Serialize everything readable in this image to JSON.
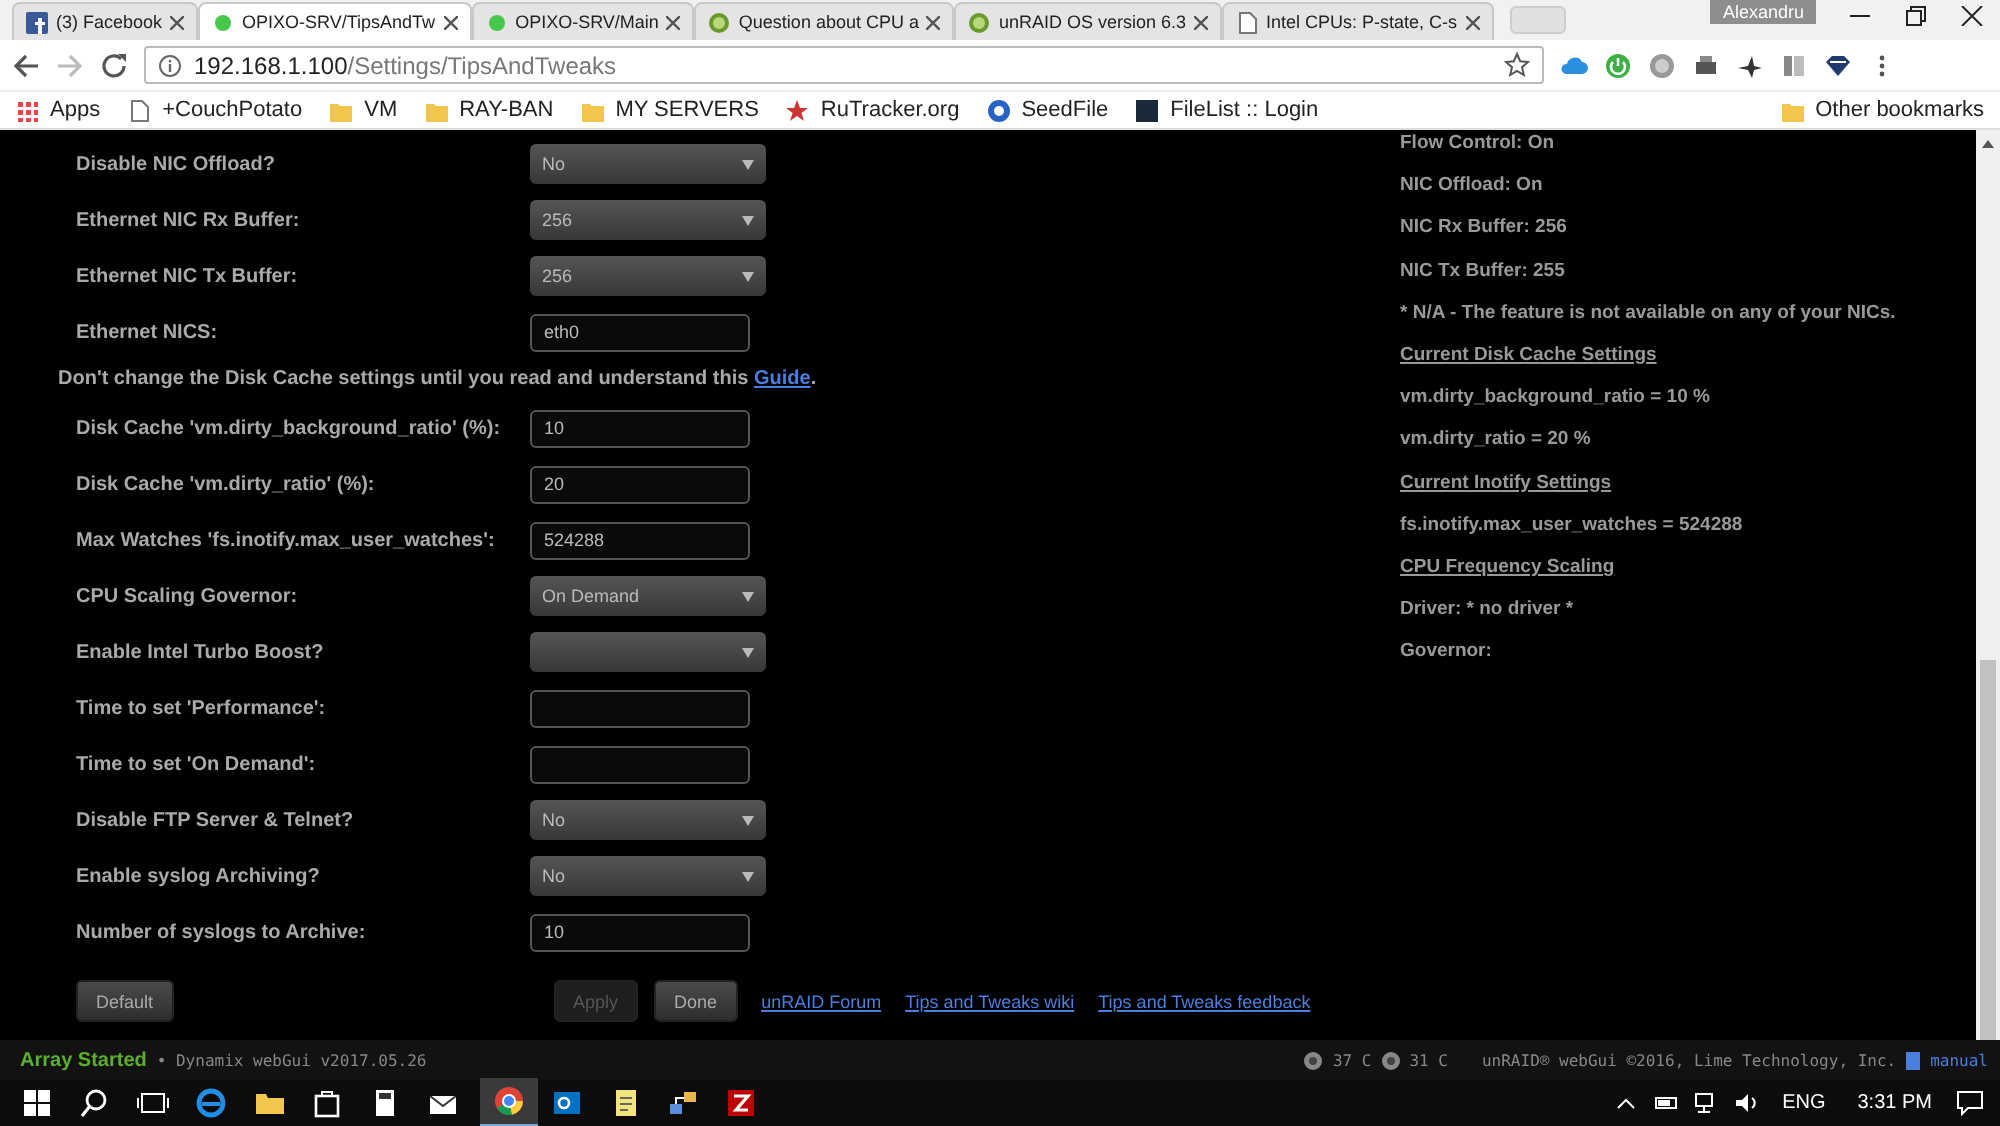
{
  "window": {
    "user": "Alexandru"
  },
  "tabs": [
    {
      "title": "(3) Facebook",
      "selected": false
    },
    {
      "title": "OPIXO-SRV/TipsAndTw",
      "selected": true
    },
    {
      "title": "OPIXO-SRV/Main",
      "selected": false
    },
    {
      "title": "Question about CPU a",
      "selected": false
    },
    {
      "title": "unRAID OS version 6.3",
      "selected": false
    },
    {
      "title": "Intel CPUs: P-state, C-s",
      "selected": false
    }
  ],
  "address": {
    "host": "192.168.1.100",
    "path": "/Settings/TipsAndTweaks"
  },
  "bookmarks": [
    "Apps",
    "+CouchPotato",
    "VM",
    "RAY-BAN",
    "MY SERVERS",
    "RuTracker.org",
    "SeedFile",
    "FileList :: Login"
  ],
  "other_bookmarks": "Other bookmarks",
  "settings": [
    {
      "kind": "select",
      "label": "Disable NIC Offload?",
      "value": "No"
    },
    {
      "kind": "select",
      "label": "Ethernet NIC Rx Buffer:",
      "value": "256"
    },
    {
      "kind": "select",
      "label": "Ethernet NIC Tx Buffer:",
      "value": "256"
    },
    {
      "kind": "input",
      "label": "Ethernet NICS:",
      "value": "eth0"
    },
    {
      "kind": "note",
      "text": "Don't change the Disk Cache settings until you read and understand this",
      "link": "Guide",
      "after": "."
    },
    {
      "kind": "input",
      "label": "Disk Cache 'vm.dirty_background_ratio' (%):",
      "value": "10"
    },
    {
      "kind": "input",
      "label": "Disk Cache 'vm.dirty_ratio' (%):",
      "value": "20"
    },
    {
      "kind": "input",
      "label": "Max Watches 'fs.inotify.max_user_watches':",
      "value": "524288"
    },
    {
      "kind": "select",
      "label": "CPU Scaling Governor:",
      "value": "On Demand"
    },
    {
      "kind": "select",
      "label": "Enable Intel Turbo Boost?"
    },
    {
      "kind": "input",
      "label": "Time to set 'Performance':"
    },
    {
      "kind": "input",
      "label": "Time to set 'On Demand':"
    },
    {
      "kind": "select",
      "label": "Disable FTP Server & Telnet?",
      "value": "No"
    },
    {
      "kind": "select",
      "label": "Enable syslog Archiving?",
      "value": "No"
    },
    {
      "kind": "input",
      "label": "Number of syslogs to Archive:",
      "value": "10"
    }
  ],
  "buttons": [
    {
      "label": "Default",
      "disabled": false
    },
    {
      "label": "Apply",
      "disabled": true
    },
    {
      "label": "Done",
      "disabled": false
    }
  ],
  "links": [
    "unRAID Forum",
    "Tips and Tweaks wiki",
    "Tips and Tweaks feedback"
  ],
  "info": [
    {
      "kind": "text",
      "text": "Flow Control: On"
    },
    {
      "kind": "text",
      "text": "NIC Offload: On"
    },
    {
      "kind": "text",
      "text": "NIC Rx Buffer: 256"
    },
    {
      "kind": "text",
      "text": "NIC Tx Buffer: 255"
    },
    {
      "kind": "text",
      "text": "* N/A - The feature is not available on any of your NICs."
    },
    {
      "kind": "heading",
      "text": "Current Disk Cache Settings"
    },
    {
      "kind": "text",
      "text": "vm.dirty_background_ratio = 10 %"
    },
    {
      "kind": "text",
      "text": "vm.dirty_ratio = 20 %"
    },
    {
      "kind": "heading",
      "text": "Current Inotify Settings"
    },
    {
      "kind": "text",
      "text": "fs.inotify.max_user_watches = 524288"
    },
    {
      "kind": "heading",
      "text": "CPU Frequency Scaling"
    },
    {
      "kind": "text",
      "text": "Driver: * no driver *"
    },
    {
      "kind": "text",
      "text": "Governor:"
    }
  ],
  "status_bar": {
    "status": "Array Started",
    "version": "• Dynamix webGui v2017.05.26",
    "temps": [
      "37 C",
      "31 C"
    ],
    "copyright": "unRAID® webGui ©2016, Lime Technology, Inc.",
    "manual": "manual"
  },
  "taskbar": {
    "language": "ENG",
    "time": "3:31 PM"
  }
}
